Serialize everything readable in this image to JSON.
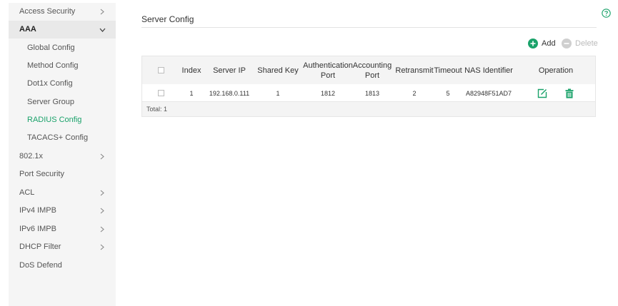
{
  "sidebar": {
    "items": [
      {
        "label": "Access Security",
        "level": "top",
        "chevron": "right"
      },
      {
        "label": "AAA",
        "level": "group",
        "chevron": "down"
      },
      {
        "label": "Global Config",
        "level": "sub"
      },
      {
        "label": "Method Config",
        "level": "sub"
      },
      {
        "label": "Dot1x Config",
        "level": "sub"
      },
      {
        "label": "Server Group",
        "level": "sub"
      },
      {
        "label": "RADIUS Config",
        "level": "sub",
        "active": true
      },
      {
        "label": "TACACS+ Config",
        "level": "sub"
      },
      {
        "label": "802.1x",
        "level": "top",
        "chevron": "right"
      },
      {
        "label": "Port Security",
        "level": "top"
      },
      {
        "label": "ACL",
        "level": "top",
        "chevron": "right"
      },
      {
        "label": "IPv4 IMPB",
        "level": "top",
        "chevron": "right"
      },
      {
        "label": "IPv6 IMPB",
        "level": "top",
        "chevron": "right"
      },
      {
        "label": "DHCP Filter",
        "level": "top",
        "chevron": "right"
      },
      {
        "label": "DoS Defend",
        "level": "top"
      }
    ]
  },
  "main": {
    "title": "Server Config",
    "add_label": "Add",
    "delete_label": "Delete",
    "table": {
      "headers": {
        "index": "Index",
        "server_ip": "Server IP",
        "shared_key": "Shared Key",
        "auth_port_line1": "Authentication",
        "auth_port_line2": "Port",
        "acct_port_line1": "Accounting",
        "acct_port_line2": "Port",
        "retransmit": "Retransmit",
        "timeout": "Timeout",
        "nas_identifier": "NAS Identifier",
        "operation": "Operation"
      },
      "rows": [
        {
          "index": "1",
          "server_ip": "192.168.0.111",
          "shared_key": "1",
          "auth_port": "1812",
          "acct_port": "1813",
          "retransmit": "2",
          "timeout": "5",
          "nas_identifier": "A82948F51AD7"
        }
      ],
      "total_label": "Total: 1"
    }
  },
  "colors": {
    "accent": "#1aa26a",
    "disabled": "#cfcfcf",
    "sidebar_bg": "#f5f5f5"
  },
  "icons": {
    "help": "question-circle-icon",
    "add": "plus-circle-icon",
    "delete": "minus-circle-icon",
    "edit": "edit-icon",
    "trash": "trash-icon",
    "chevron_right": "chevron-right-icon",
    "chevron_down": "chevron-down-icon"
  }
}
